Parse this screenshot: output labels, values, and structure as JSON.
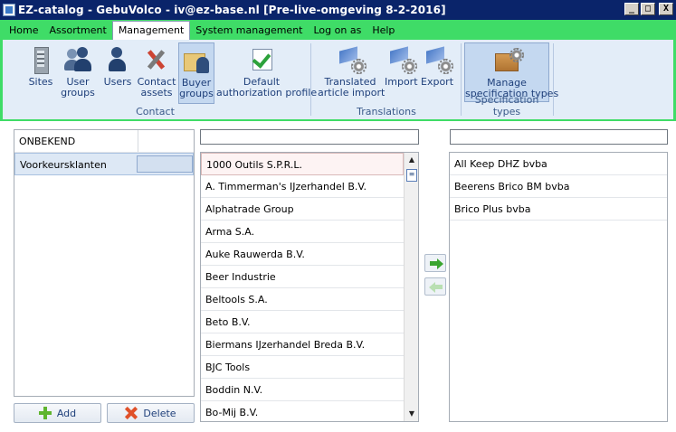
{
  "window": {
    "title": "EZ-catalog - GebuVolco - iv@ez-base.nl [Pre-live-omgeving 8-2-2016]",
    "minimize": "_",
    "maximize": "□",
    "close": "X"
  },
  "menu": {
    "items": [
      "Home",
      "Assortment",
      "Management",
      "System management",
      "Log on as",
      "Help"
    ],
    "active": "Management"
  },
  "ribbon": {
    "groups": [
      {
        "title": "Contact",
        "buttons": [
          {
            "line1": "Sites",
            "line2": "",
            "icon": "building-icon"
          },
          {
            "line1": "User",
            "line2": "groups",
            "icon": "user-group-icon"
          },
          {
            "line1": "Users",
            "line2": "",
            "icon": "users-icon"
          },
          {
            "line1": "Contact",
            "line2": "assets",
            "icon": "tools-icon"
          },
          {
            "line1": "Buyer",
            "line2": "groups",
            "icon": "buyer-group-icon"
          },
          {
            "line1": "Default",
            "line2": "authorization profile",
            "icon": "checkmark-icon"
          }
        ]
      },
      {
        "title": "Translations",
        "buttons": [
          {
            "line1": "Translated",
            "line2": "article import",
            "icon": "translate-import-icon"
          },
          {
            "line1": "Import",
            "line2": "",
            "icon": "import-icon"
          },
          {
            "line1": "Export",
            "line2": "",
            "icon": "export-icon"
          }
        ]
      },
      {
        "title": "Specification types",
        "buttons": [
          {
            "line1": "Manage",
            "line2": "specification types",
            "icon": "box-gear-icon"
          }
        ]
      }
    ]
  },
  "groups_list": {
    "items": [
      "ONBEKEND",
      "Voorkeursklanten"
    ],
    "selected": "Voorkeursklanten"
  },
  "available_search": {
    "value": ""
  },
  "available_list": {
    "items": [
      "1000 Outils S.P.R.L.",
      "A. Timmerman's IJzerhandel B.V.",
      "Alphatrade Group",
      "Arma S.A.",
      "Auke Rauwerda B.V.",
      "Beer Industrie",
      "Beltools S.A.",
      "Beto B.V.",
      "Biermans IJzerhandel Breda B.V.",
      "BJC Tools",
      "Boddin N.V.",
      "Bo-Mij B.V."
    ]
  },
  "assigned_search": {
    "value": ""
  },
  "assigned_list": {
    "items": [
      "All Keep DHZ bvba",
      "Beerens Brico BM bvba",
      "Brico Plus bvba"
    ]
  },
  "actions": {
    "add": "Add",
    "delete": "Delete"
  }
}
